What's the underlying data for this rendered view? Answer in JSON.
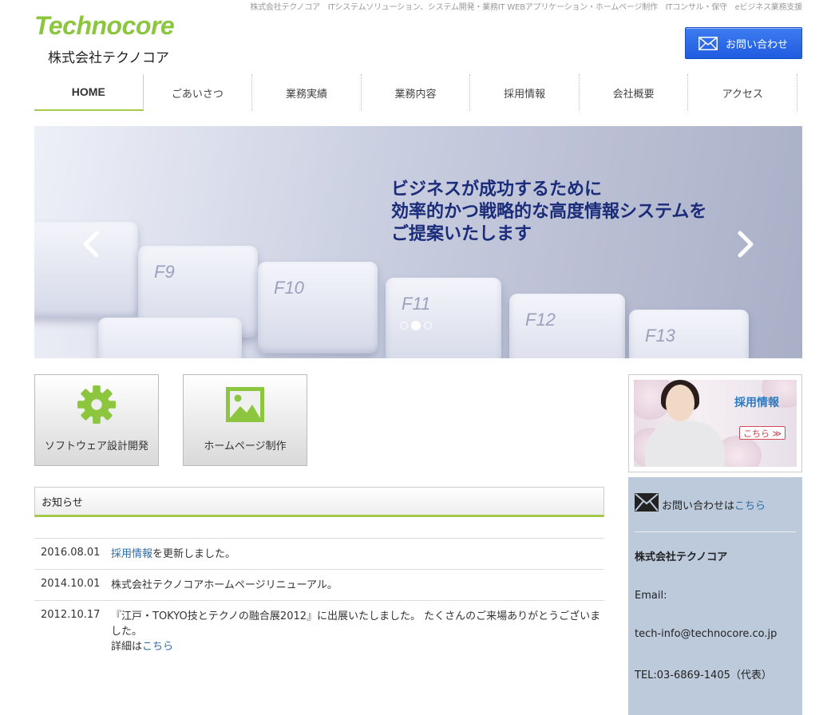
{
  "header": {
    "tagline": "株式会社テクノコア　ITシステムソリューション、システム開発・業務IT WEBアプリケーション・ホームページ制作　ITコンサル・保守　eビジネス業務支援",
    "logo_en": "Technocore",
    "logo_jp": "株式会社テクノコア",
    "contact_button": "お問い合わせ"
  },
  "nav": {
    "items": [
      {
        "label": "HOME",
        "active": true
      },
      {
        "label": "ごあいさつ"
      },
      {
        "label": "業務実績"
      },
      {
        "label": "業務内容"
      },
      {
        "label": "採用情報"
      },
      {
        "label": "会社概要"
      },
      {
        "label": "アクセス"
      }
    ]
  },
  "slider": {
    "text_line1": "ビジネスが成功するために",
    "text_line2": "効率的かつ戦略的な高度情報システムを",
    "text_line3": "ご提案いたします",
    "key_labels": [
      "F9",
      "F10",
      "F11",
      "F12",
      "F13"
    ],
    "dots": 3,
    "active_dot": 2
  },
  "services": [
    {
      "label": "ソフトウェア設計開発",
      "icon": "gear-icon"
    },
    {
      "label": "ホームページ制作",
      "icon": "image-icon"
    }
  ],
  "news": {
    "title": "お知らせ",
    "items": [
      {
        "date": "2016.08.01",
        "link": "採用情報",
        "text": "を更新しました。"
      },
      {
        "date": "2014.10.01",
        "text": "株式会社テクノコアホームページリニューアル。"
      },
      {
        "date": "2012.10.17",
        "text": "『江戸・TOKYO技とテクノの融合展2012』に出展いたしました。 たくさんのご来場ありがとうございました。",
        "detail_prefix": "詳細は",
        "detail_link": "こちら"
      }
    ]
  },
  "sidebar": {
    "recruit_title": "採用情報",
    "recruit_button": "こちら ≫",
    "contact_text": "お問い合わせは",
    "contact_link": "こちら",
    "company": "株式会社テクノコア",
    "email_label": "Email:",
    "email": "tech-info@technocore.co.jp",
    "tel": "TEL:03-6869-1405（代表）"
  },
  "colors": {
    "brand_green": "#8cc63f",
    "accent_blue": "#2a6ea8",
    "button_blue": "#2a63e6",
    "sidebar_bg": "#bccadb"
  }
}
